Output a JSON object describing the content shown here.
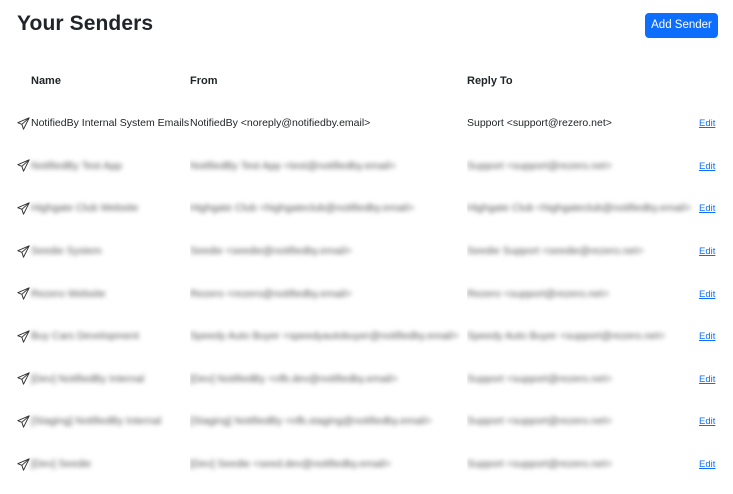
{
  "page": {
    "title": "Your Senders",
    "add_button_label": "Add Sender"
  },
  "table": {
    "headers": {
      "name": "Name",
      "from": "From",
      "reply_to": "Reply To"
    },
    "edit_label": "Edit",
    "rows": [
      {
        "name": "NotifiedBy Internal System Emails",
        "from": "NotifiedBy <noreply@notifiedby.email>",
        "reply_to": "Support <support@rezero.net>",
        "blurred": false
      },
      {
        "name": "NotifiedBy Test App",
        "from": "NotifiedBy Test App <test@notifiedby.email>",
        "reply_to": "Support <support@rezero.net>",
        "blurred": true
      },
      {
        "name": "Highgate Club Website",
        "from": "Highgate Club <highgateclub@notifiedby.email>",
        "reply_to": "Highgate Club <highgateclub@notifiedby.email>",
        "blurred": true
      },
      {
        "name": "Seedie System",
        "from": "Seedie <seedie@notifiedby.email>",
        "reply_to": "Seedie Support <seedie@rezero.net>",
        "blurred": true
      },
      {
        "name": "Rezero Website",
        "from": "Rezero <rezero@notifiedby.email>",
        "reply_to": "Rezero <support@rezero.net>",
        "blurred": true
      },
      {
        "name": "Buy Cars Development",
        "from": "Speedy Auto Buyer <speedyautobuyer@notifiedby.email>",
        "reply_to": "Speedy Auto Buyer <support@rezero.net>",
        "blurred": true
      },
      {
        "name": "[Dev] NotifiedBy Internal",
        "from": "[Dev] NotifiedBy <nfb.dev@notifiedby.email>",
        "reply_to": "Support <support@rezero.net>",
        "blurred": true
      },
      {
        "name": "[Staging] NotifiedBy Internal",
        "from": "[Staging] NotifiedBy <nfb.staging@notifiedby.email>",
        "reply_to": "Support <support@rezero.net>",
        "blurred": true
      },
      {
        "name": "[Dev] Seedie",
        "from": "[Dev] Seedie <seed.dev@notifiedby.email>",
        "reply_to": "Support <support@rezero.net>",
        "blurred": true
      }
    ]
  },
  "icons": {
    "sender": "paper-plane-icon"
  },
  "colors": {
    "accent": "#0d6efd",
    "text": "#212529"
  }
}
